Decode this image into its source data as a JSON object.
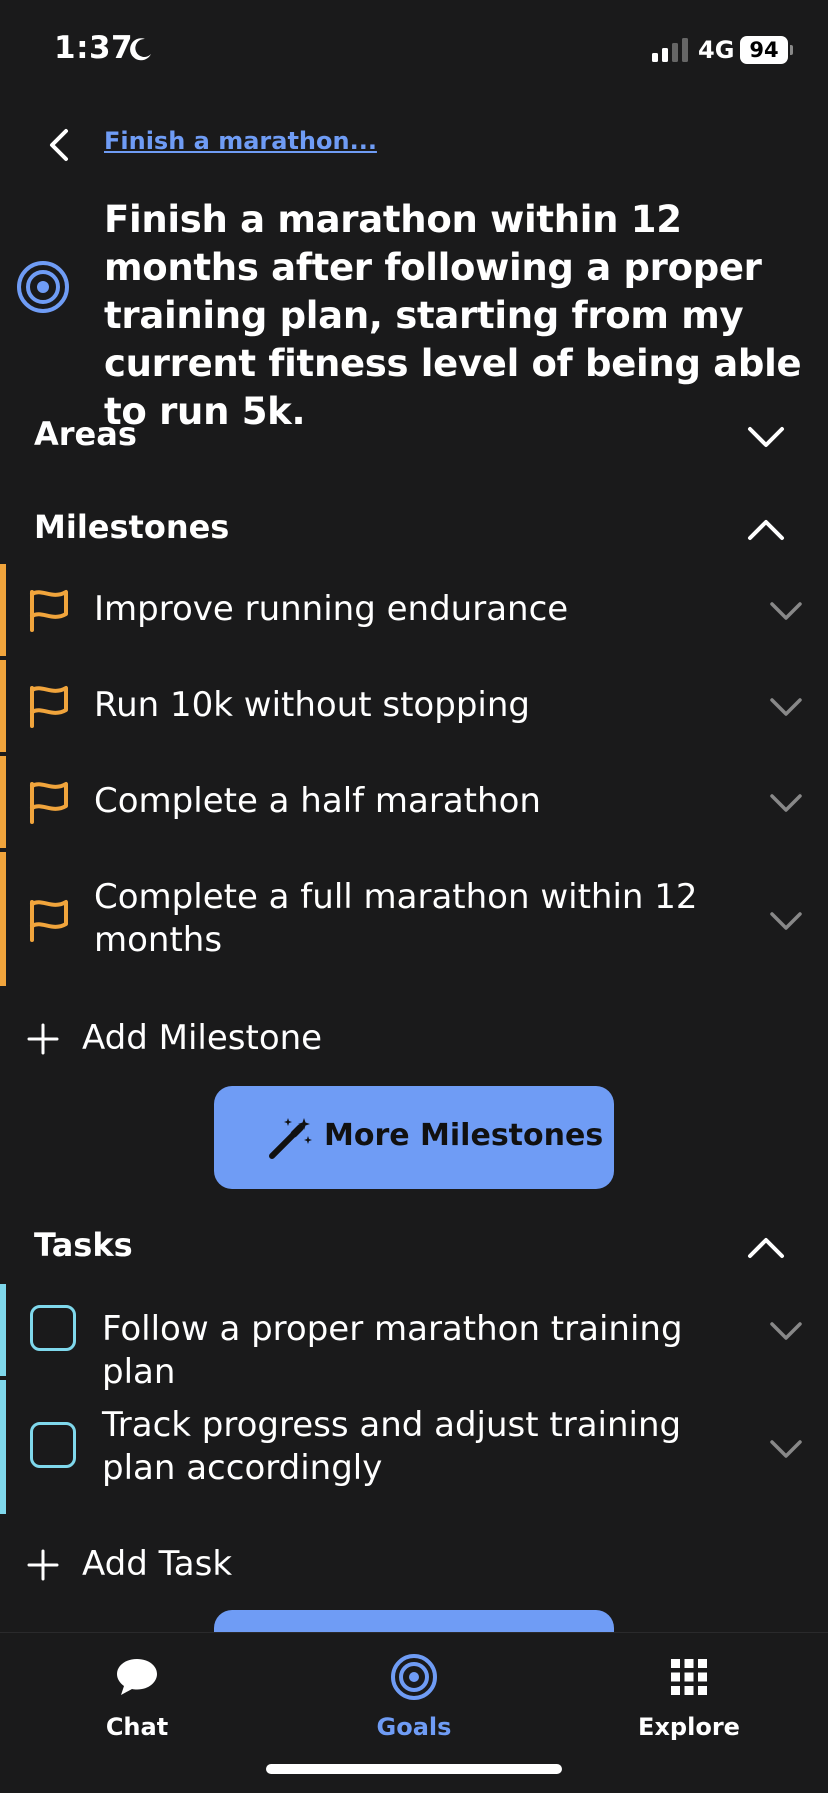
{
  "status_bar": {
    "time": "1:37",
    "network": "4G",
    "battery": "94"
  },
  "header": {
    "breadcrumb": "Finish a marathon..."
  },
  "goal": {
    "title": "Finish a marathon within 12 months after following a proper training plan, starting from my current fitness level of being able to run 5k.",
    "icon": "target-icon"
  },
  "sections": {
    "areas": {
      "label": "Areas",
      "state": "collapsed"
    },
    "milestones": {
      "label": "Milestones",
      "state": "expanded"
    },
    "tasks": {
      "label": "Tasks",
      "state": "expanded"
    }
  },
  "milestones": [
    {
      "label": "Improve running endurance"
    },
    {
      "label": "Run 10k without stopping"
    },
    {
      "label": "Complete a half marathon"
    },
    {
      "label": "Complete a full marathon within 12 months"
    }
  ],
  "add_milestone_label": "Add Milestone",
  "more_milestones_label": "More Milestones",
  "tasks": [
    {
      "label": "Follow a proper marathon training plan",
      "checked": false
    },
    {
      "label": "Track progress and adjust training plan accordingly",
      "checked": false
    }
  ],
  "add_task_label": "Add Task",
  "tab_bar": {
    "tabs": [
      {
        "label": "Chat",
        "icon": "chat-bubble-icon",
        "active": false
      },
      {
        "label": "Goals",
        "icon": "target-icon",
        "active": true
      },
      {
        "label": "Explore",
        "icon": "grid-icon",
        "active": false
      }
    ]
  },
  "colors": {
    "background": "#1a1a1b",
    "accent_blue": "#6f9cf5",
    "milestone_orange": "#f0a43c",
    "task_cyan": "#7fd8ec"
  }
}
